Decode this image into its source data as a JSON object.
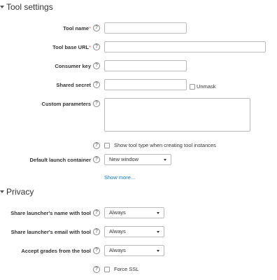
{
  "tool_settings": {
    "heading": "Tool settings",
    "tool_name": {
      "label": "Tool name",
      "required_mark": "*",
      "value": ""
    },
    "tool_base_url": {
      "label": "Tool base URL",
      "required_mark": "*",
      "value": ""
    },
    "consumer_key": {
      "label": "Consumer key",
      "value": ""
    },
    "shared_secret": {
      "label": "Shared secret",
      "value": "",
      "unmask_label": "Unmask",
      "unmask_checked": false
    },
    "custom_parameters": {
      "label": "Custom parameters",
      "value": ""
    },
    "show_tool_type": {
      "label": "Show tool type when creating tool instances",
      "checked": false
    },
    "default_launch_container": {
      "label": "Default launch container",
      "selected": "New window"
    },
    "show_more_link": "Show more..."
  },
  "privacy": {
    "heading": "Privacy",
    "share_name": {
      "label": "Share launcher's name with tool",
      "selected": "Always"
    },
    "share_email": {
      "label": "Share launcher's email with tool",
      "selected": "Always"
    },
    "accept_grades": {
      "label": "Accept grades from the tool",
      "selected": "Always"
    },
    "force_ssl": {
      "label": "Force SSL",
      "checked": false
    }
  },
  "icons": {
    "help": "question-circle-icon",
    "section_toggle": "chevron-down-icon",
    "select_caret": "caret-down-icon",
    "help_glyph": "?"
  },
  "colors": {
    "link": "#1177d1",
    "required": "#d9534f",
    "input_border": "#bbbbbb",
    "text": "#333333"
  }
}
